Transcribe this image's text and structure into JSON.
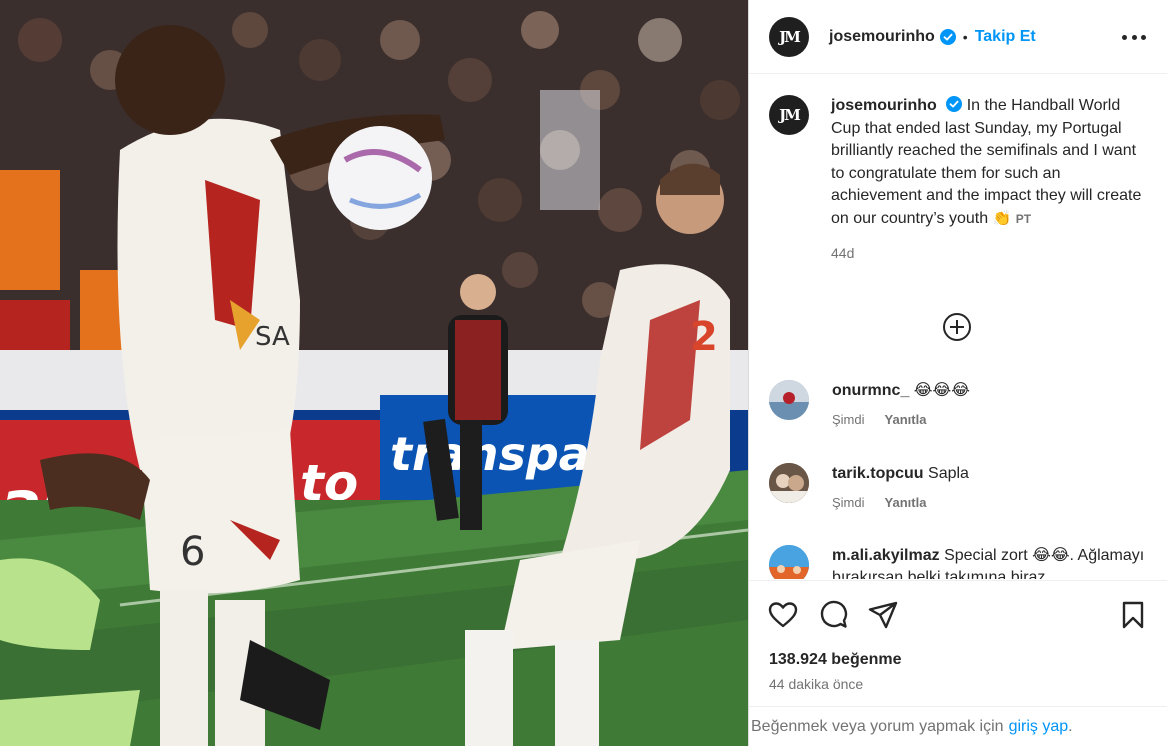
{
  "account": {
    "username": "josemourinho",
    "avatar_initials": "JM",
    "follow_label": "Takip Et",
    "separator": "•",
    "verified_icon": "verified-badge-icon",
    "more_icon": "more-options-icon"
  },
  "caption": {
    "username": "josemourinho",
    "text": "In the Handball World Cup that ended last Sunday, my Portugal brilliantly reached the semifinals and I want to congratulate them for such an achievement and the impact they will create on our country’s youth",
    "emoji": "👏",
    "flag_label": "PT",
    "age": "44d"
  },
  "load_more_icon": "plus-circle-icon",
  "comments": [
    {
      "username": "onurmnc_",
      "text": "😂😂😂",
      "time": "Şimdi",
      "reply_label": "Yanıtla"
    },
    {
      "username": "tarik.topcuu",
      "text": "Sapla",
      "time": "Şimdi",
      "reply_label": "Yanıtla"
    },
    {
      "username": "m.ali.akyilmaz",
      "text": "Special zort 😂😂. Ağlamayı bırakırsan belki takımına biraz",
      "time": "",
      "reply_label": ""
    }
  ],
  "actions": {
    "like_icon": "heart-icon",
    "comment_icon": "comment-icon",
    "share_icon": "share-icon",
    "save_icon": "bookmark-icon"
  },
  "likes": "138.924 beğenme",
  "timestamp": "44 dakika önce",
  "login_prompt": {
    "text": "Beğenmek veya yorum yapmak için",
    "link": "giriş yap",
    "suffix": "."
  },
  "photo": {
    "board_left_text": "asi",
    "board_mid_text": "to",
    "board_right_text": "transpale",
    "shirt_number": "6",
    "shirt_number_2": "2",
    "shirt_sponsor": "SA"
  },
  "colors": {
    "link_blue": "#0095f6",
    "text_primary": "#262626",
    "text_secondary": "#737373",
    "border": "#dbdbdb"
  }
}
